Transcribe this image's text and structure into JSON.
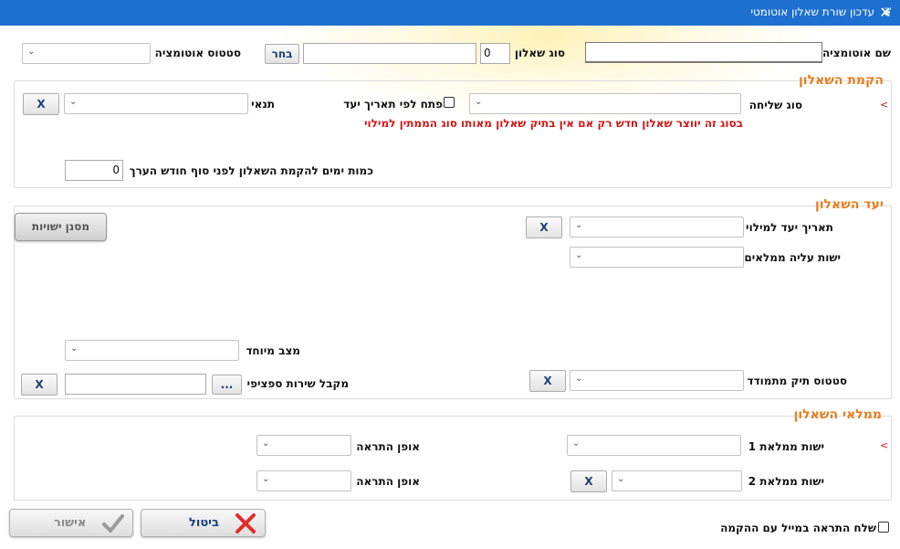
{
  "window": {
    "title": "עדכון שורת שאלון אוטומטי",
    "close_glyph": "✕",
    "logo_glyph": "❦"
  },
  "top": {
    "automation_name_label": "שם אוטומציה",
    "automation_name_value": "",
    "questionnaire_type_label": "סוג שאלון",
    "questionnaire_type_code": "0",
    "questionnaire_type_name": "",
    "choose_button": "בחר",
    "automation_status_label": "סטטוס אוטומציה",
    "automation_status_value": ""
  },
  "setup": {
    "title": "הקמת השאלון",
    "send_type_label": "סוג שליחה",
    "send_type_value": "",
    "open_by_date_label": "פתח לפי תאריך יעד",
    "open_by_date_checked": false,
    "condition_label": "תנאי",
    "condition_value": "",
    "clear_button": "X",
    "info_text": "בסוג זה יווצר שאלון חדש רק אם אין בתיק שאלון מאותו סוג הממתין למילוי",
    "days_before_label": "כמות ימים להקמת השאלון לפני סוף חודש הערך",
    "days_before_value": "0"
  },
  "target": {
    "title": "יעד השאלון",
    "due_date_label": "תאריך יעד למילוי",
    "due_date_value": "",
    "entity_label": "ישות עליה ממלאים",
    "entity_value": "",
    "filter_button": "מסנן ישויות",
    "special_state_label": "מצב מיוחד",
    "special_state_value": "",
    "file_status_label": "סטטוס תיק מתמודד",
    "file_status_value": "",
    "service_recipient_label": "מקבל שירות ספציפי",
    "service_recipient_value": "",
    "ellipsis_button": "...",
    "clear_button": "X"
  },
  "fillers": {
    "title": "ממלאי השאלון",
    "filler1_label": "ישות ממלאת 1",
    "filler1_value": "",
    "alert1_label": "אופן התראה",
    "alert1_value": "",
    "filler2_label": "ישות ממלאת 2",
    "filler2_value": "",
    "alert2_label": "אופן התראה",
    "alert2_value": "",
    "clear_button": "X"
  },
  "footer": {
    "send_mail_label": "שלח התראה במייל עם ההקמה",
    "send_mail_checked": false,
    "cancel_label": "ביטול",
    "ok_label": "אישור"
  },
  "colors": {
    "titlebar": "#1d6fd0",
    "group_title": "#e87d1e",
    "required_marker": "#d31515",
    "info_text": "#d31515"
  },
  "icons": {
    "dropdown": "chevron-down-icon",
    "cancel": "red-x-icon",
    "ok": "checkmark-icon"
  }
}
